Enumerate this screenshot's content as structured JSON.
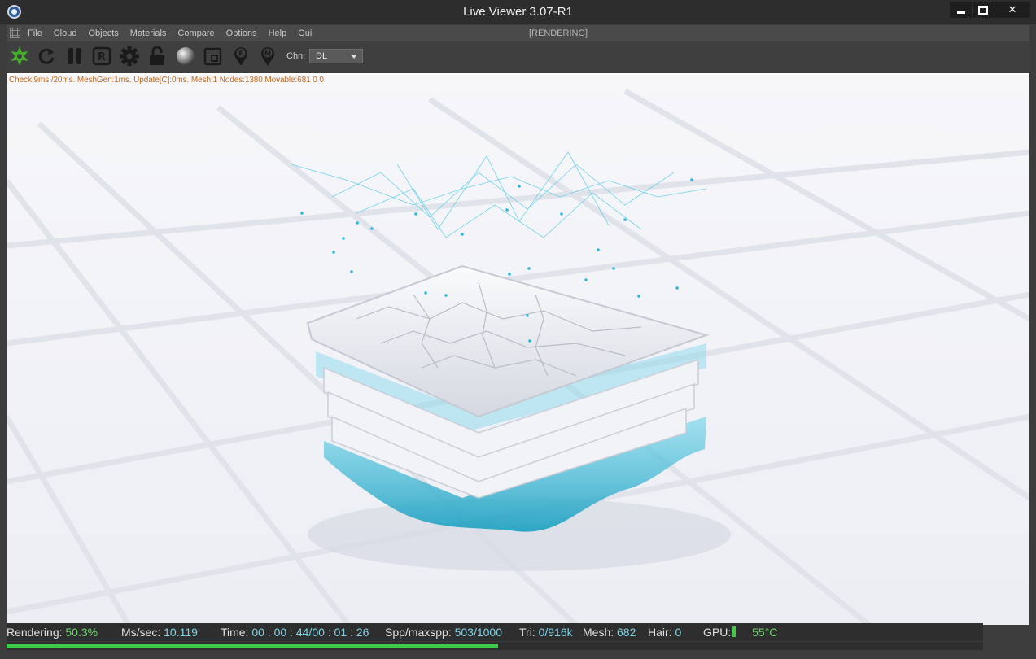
{
  "window": {
    "title": "Live Viewer 3.07-R1",
    "minimize": "minimize",
    "maximize": "maximize",
    "close": "✕"
  },
  "menu": {
    "items": [
      "File",
      "Cloud",
      "Objects",
      "Materials",
      "Compare",
      "Options",
      "Help",
      "Gui"
    ],
    "status": "[RENDERING]"
  },
  "toolbar": {
    "buttons": [
      {
        "name": "render-start-icon",
        "color": "#43b02a"
      },
      {
        "name": "refresh-icon"
      },
      {
        "name": "pause-icon"
      },
      {
        "name": "region-render-icon",
        "glyph": "R"
      },
      {
        "name": "settings-gear-icon"
      },
      {
        "name": "lock-icon"
      },
      {
        "name": "material-sphere-icon"
      },
      {
        "name": "crop-region-icon"
      },
      {
        "name": "focus-pin-icon",
        "glyph": "F"
      },
      {
        "name": "material-pin-icon",
        "glyph": "M"
      }
    ],
    "channel_label": "Chn:",
    "channel_value": "DL"
  },
  "viewport": {
    "debug": "Check:9ms./20ms. MeshGen:1ms. Update[C]:0ms. Mesh:1 Nodes:1380 Movable:681  0 0"
  },
  "status": {
    "rendering_label": "Rendering:",
    "rendering_value": "50.3%",
    "mssec_label": "Ms/sec:",
    "mssec_value": "10.119",
    "time_label": "Time:",
    "time_value": "00 : 00 : 44/00 : 01 : 26",
    "spp_label": "Spp/maxspp:",
    "spp_value": "503/1000",
    "tri_label": "Tri:",
    "tri_value": "0/916k",
    "mesh_label": "Mesh:",
    "mesh_value": "682",
    "hair_label": "Hair:",
    "hair_value": "0",
    "gpu_label": "GPU:",
    "gpu_temp": "55°C",
    "progress_fraction": 0.503
  },
  "colors": {
    "accent_green": "#43b02a",
    "value_cyan": "#7fd3e6",
    "debug_orange": "#c06a1e"
  }
}
